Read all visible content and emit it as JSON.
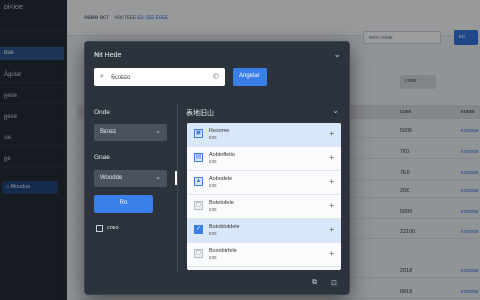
{
  "sidebar": {
    "brand": "ᴅi<ioe",
    "items": [
      "",
      "ᴅse",
      "Ᾱgular",
      "ᵷese",
      "ᵷese",
      "ᵢse",
      "ᵷe",
      "ᵦeleᵗ"
    ],
    "active_index": 1,
    "tag": "Ꞥoudue"
  },
  "main": {
    "crumb": [
      "ᴙɘᴍɘ ɘᴄᴛ",
      "ᴙɘᴄᴛᴇᴇᴇ",
      "ᴇᴏ ᴄᴇᴇ ᴇᴏᴇᴇ"
    ],
    "filter_placeholder": "ᴍᴏᴏ ᴄᴏᴍᴇ",
    "primary_label": "ᴇᴏ",
    "export_label": "ᴄᴏᴏᴇ",
    "table": {
      "headers": [
        "ᴄᴏᴇᴇ",
        "ᴇᴏᴇᴇᴇ"
      ],
      "rows": [
        {
          "num": "5006",
          "link": "ᴇᴏᴏᴏᴏᴇ"
        },
        {
          "num": "7€0",
          "link": "ᴇᴏᴏᴏᴏᴇ"
        },
        {
          "num": "7E6",
          "link": "ᴇᴏᴏᴏᴏᴇ"
        },
        {
          "num": "20€",
          "link": "ᴇᴏᴏᴏᴏᴇ"
        },
        {
          "num": "5000",
          "link": "ᴇᴏᴏᴏᴏᴇ"
        },
        {
          "num": "23100",
          "link": "ᴇᴏᴏᴏᴏᴇ"
        },
        {
          "num": "2018",
          "link": "ᴇᴏᴏᴏᴏᴇ"
        },
        {
          "num": "6818",
          "link": "ᴇᴏᴏᴏᴏᴇ"
        }
      ]
    }
  },
  "modal": {
    "title": "Ꞥit Hede",
    "search_value": "Ꞩᴄᴏᴇᴇᴏ",
    "apply_label": "Angelar",
    "left": {
      "label1": "Onde",
      "select1": "Bᴇᴏᴇᴇ",
      "label2": "Gnae",
      "select2": "Woodde",
      "go_label": "Rᴏ",
      "check_label": "ᴄᴏᴇᴏ"
    },
    "right": {
      "title": "表地旧山",
      "items": [
        {
          "name": "Resome",
          "sub": "ᴇᴏᴇ",
          "icon": "image-icon",
          "selected": true
        },
        {
          "name": "Aobtofletio",
          "sub": "ᴇᴏᴇ",
          "icon": "file-icon",
          "selected": false
        },
        {
          "name": "Aobodele",
          "sub": "ᴇᴏᴇ",
          "icon": "alert-icon",
          "selected": false
        },
        {
          "name": "Botetofele",
          "sub": "ᴇᴏᴇ",
          "icon": "doc-icon",
          "selected": false
        },
        {
          "name": "Botoblotdeie",
          "sub": "ᴇᴏᴇ",
          "icon": "check-icon",
          "selected": true
        },
        {
          "name": "Bosobtrfele",
          "sub": "ᴇᴏᴇ",
          "icon": "doc-icon",
          "selected": false
        }
      ]
    }
  }
}
